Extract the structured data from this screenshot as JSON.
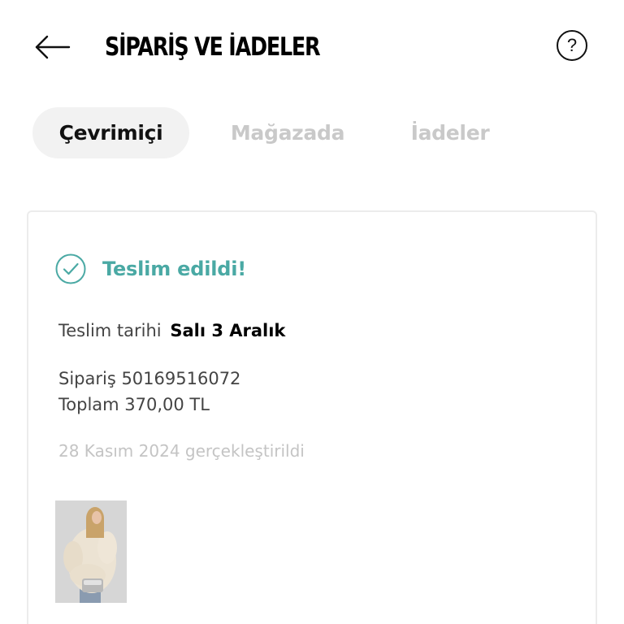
{
  "header": {
    "title": "SİPARİŞ VE İADELER",
    "back_icon": "arrow-left-icon",
    "help_icon": "help-circle-icon",
    "help_glyph": "?"
  },
  "tabs": [
    {
      "label": "Çevrimiçi",
      "active": true
    },
    {
      "label": "Mağazada",
      "active": false
    },
    {
      "label": "İadeler",
      "active": false
    }
  ],
  "order": {
    "status": "Teslim edildi!",
    "status_icon": "check-circle-icon",
    "delivery_label": "Teslim tarihi",
    "delivery_date": "Salı 3 Aralık",
    "order_number_line": "Sipariş 50169516072",
    "total_line": "Toplam 370,00 TL",
    "placed_line": "28 Kasım 2024 gerçekleştirildi"
  },
  "colors": {
    "accent": "#4aa9a4",
    "inactive_tab": "#c9c9c9",
    "active_tab_bg": "#f2f2f2",
    "muted_text": "#c4c4c4",
    "card_border": "#ececec"
  }
}
